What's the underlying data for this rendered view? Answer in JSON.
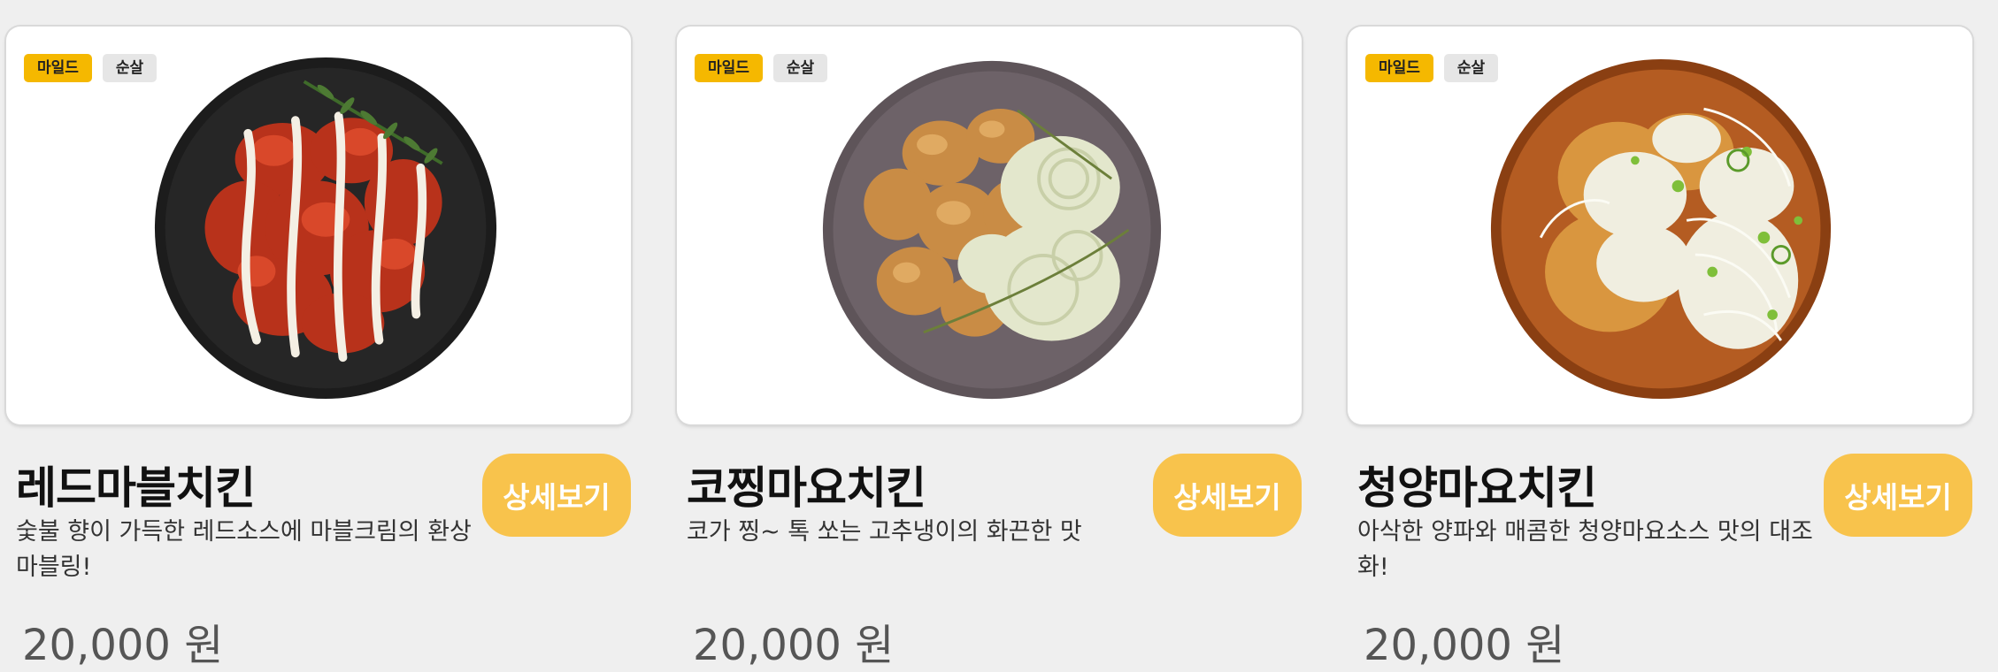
{
  "items": [
    {
      "tags": [
        "마일드",
        "순살"
      ],
      "name": "레드마블치킨",
      "description": "숯불 향이 가득한 레드소스에 마블크림의 환상 마블링!",
      "price": "20,000 원",
      "button_label": "상세보기",
      "image": "red-marble-chicken-plate"
    },
    {
      "tags": [
        "마일드",
        "순살"
      ],
      "name": "코찡마요치킨",
      "description": "코가 찡~ 톡 쏘는 고추냉이의 화끈한 맛",
      "price": "20,000 원",
      "button_label": "상세보기",
      "image": "wasabi-mayo-chicken-plate"
    },
    {
      "tags": [
        "마일드",
        "순살"
      ],
      "name": "청양마요치킨",
      "description": "아삭한 양파와 매콤한 청양마요소스 맛의 대조화!",
      "price": "20,000 원",
      "button_label": "상세보기",
      "image": "cheongyang-mayo-chicken-plate"
    }
  ],
  "colors": {
    "mild_tag": "#f5b800",
    "boneless_tag": "#e6e6e6",
    "button": "#f8c34c",
    "page_bg": "#efefef"
  }
}
